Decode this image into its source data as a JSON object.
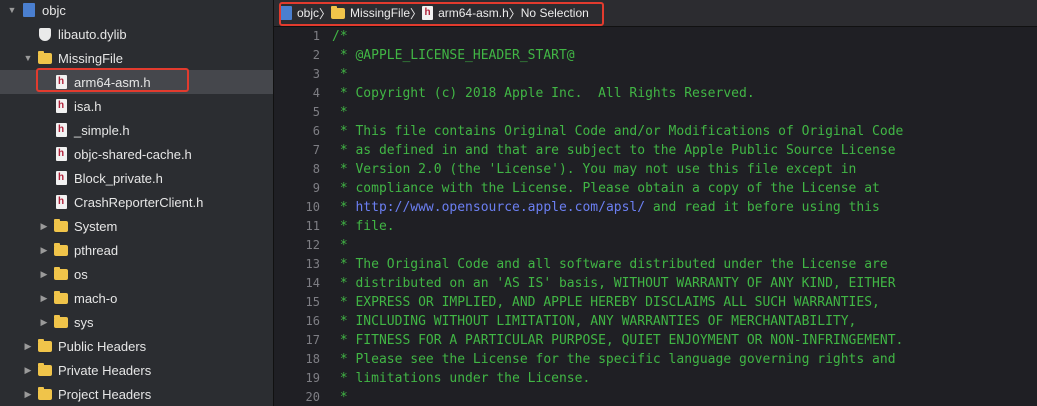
{
  "sidebar": {
    "items": [
      {
        "label": "objc",
        "icon": "project-icon",
        "expanded": true,
        "indent": 0
      },
      {
        "label": "libauto.dylib",
        "icon": "library-icon",
        "indent": 1
      },
      {
        "label": "MissingFile",
        "icon": "folder-icon",
        "expanded": true,
        "indent": 1
      },
      {
        "label": "arm64-asm.h",
        "icon": "header-file-icon",
        "indent": 2,
        "selected": true
      },
      {
        "label": "isa.h",
        "icon": "header-file-icon",
        "indent": 2
      },
      {
        "label": "_simple.h",
        "icon": "header-file-icon",
        "indent": 2
      },
      {
        "label": "objc-shared-cache.h",
        "icon": "header-file-icon",
        "indent": 2
      },
      {
        "label": "Block_private.h",
        "icon": "header-file-icon",
        "indent": 2
      },
      {
        "label": "CrashReporterClient.h",
        "icon": "header-file-icon",
        "indent": 2
      },
      {
        "label": "System",
        "icon": "folder-icon",
        "expanded": false,
        "indent": 2
      },
      {
        "label": "pthread",
        "icon": "folder-icon",
        "expanded": false,
        "indent": 2
      },
      {
        "label": "os",
        "icon": "folder-icon",
        "expanded": false,
        "indent": 2
      },
      {
        "label": "mach-o",
        "icon": "folder-icon",
        "expanded": false,
        "indent": 2
      },
      {
        "label": "sys",
        "icon": "folder-icon",
        "expanded": false,
        "indent": 2
      },
      {
        "label": "Public Headers",
        "icon": "folder-icon",
        "expanded": false,
        "indent": 1
      },
      {
        "label": "Private Headers",
        "icon": "folder-icon",
        "expanded": false,
        "indent": 1
      },
      {
        "label": "Project Headers",
        "icon": "folder-icon",
        "expanded": false,
        "indent": 1
      }
    ]
  },
  "jumpbar": {
    "crumbs": [
      "objc",
      "MissingFile",
      "arm64-asm.h",
      "No Selection"
    ]
  },
  "editor": {
    "lines": [
      {
        "n": "1",
        "text": "/*"
      },
      {
        "n": "2",
        "text": " * @APPLE_LICENSE_HEADER_START@"
      },
      {
        "n": "3",
        "text": " *"
      },
      {
        "n": "4",
        "text": " * Copyright (c) 2018 Apple Inc.  All Rights Reserved."
      },
      {
        "n": "5",
        "text": " *"
      },
      {
        "n": "6",
        "text": " * This file contains Original Code and/or Modifications of Original Code"
      },
      {
        "n": "7",
        "text": " * as defined in and that are subject to the Apple Public Source License"
      },
      {
        "n": "8",
        "text": " * Version 2.0 (the 'License'). You may not use this file except in"
      },
      {
        "n": "9",
        "text": " * compliance with the License. Please obtain a copy of the License at"
      },
      {
        "n": "10",
        "pre": " * ",
        "url": "http://www.opensource.apple.com/apsl/",
        "post": " and read it before using this"
      },
      {
        "n": "11",
        "text": " * file."
      },
      {
        "n": "12",
        "text": " *"
      },
      {
        "n": "13",
        "text": " * The Original Code and all software distributed under the License are"
      },
      {
        "n": "14",
        "text": " * distributed on an 'AS IS' basis, WITHOUT WARRANTY OF ANY KIND, EITHER"
      },
      {
        "n": "15",
        "text": " * EXPRESS OR IMPLIED, AND APPLE HEREBY DISCLAIMS ALL SUCH WARRANTIES,"
      },
      {
        "n": "16",
        "text": " * INCLUDING WITHOUT LIMITATION, ANY WARRANTIES OF MERCHANTABILITY,"
      },
      {
        "n": "17",
        "text": " * FITNESS FOR A PARTICULAR PURPOSE, QUIET ENJOYMENT OR NON-INFRINGEMENT."
      },
      {
        "n": "18",
        "text": " * Please see the License for the specific language governing rights and"
      },
      {
        "n": "19",
        "text": " * limitations under the License."
      },
      {
        "n": "20",
        "text": " *"
      }
    ]
  },
  "colors": {
    "comment": "#41b645",
    "url": "#6b7ff2",
    "highlight": "#e23b2e"
  }
}
